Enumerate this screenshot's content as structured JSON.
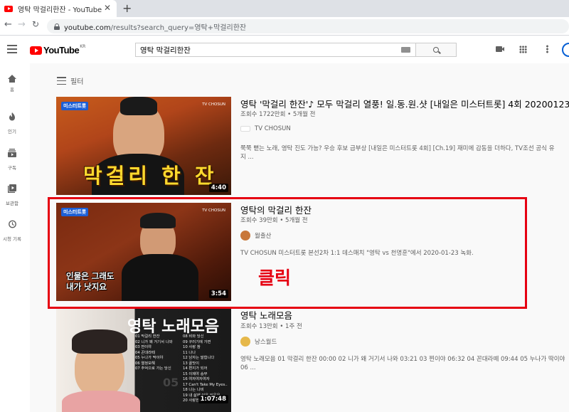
{
  "browser": {
    "tab_title": "영탁 막걸리한잔 - YouTube",
    "url_host": "youtube.com",
    "url_path": "/results?search_query=영탁+막걸리한잔"
  },
  "masthead": {
    "logo_text": "YouTube",
    "logo_region": "KR",
    "search_value": "영탁 막걸리한잔"
  },
  "guide": [
    {
      "label": "홈",
      "icon": "home-icon"
    },
    {
      "label": "인기",
      "icon": "fire-icon"
    },
    {
      "label": "구독",
      "icon": "subscriptions-icon"
    },
    {
      "label": "보관함",
      "icon": "library-icon"
    },
    {
      "label": "시청 기록",
      "icon": "history-icon"
    }
  ],
  "filter_label": "필터",
  "results": [
    {
      "title": "영탁 '막걸리 한잔'♪ 모두 막걸리 열풍! 일.동.원.샷 [내일은 미스터트롯] 4회 20200123",
      "meta": "조회수 1722만회 • 5개월 전",
      "channel": "TV CHOSUN",
      "desc_line1": "쭉쭉 뻗는 노래, 영탁 진도 가능? 우승 후보 급부상 [내일은 미스터트롯 4회] [Ch.19] 재미에 감동을 더하다, TV조선 공식 유",
      "desc_line2": "지 ...",
      "duration": "4:40",
      "thumb_caption": "막걸리 한 잔",
      "thumb_logo": "미스터트롯",
      "thumb_brand": "TV CHOSUN"
    },
    {
      "title": "영탁의 막걸리 한잔",
      "meta": "조회수 39만회 • 5개월 전",
      "channel": "월출산",
      "desc_line1": "TV CHOSUN 미스터트롯 본선2차 1:1 데스매치 \"영탁 vs 천명훈\"에서 2020-01-23 녹화.",
      "desc_line2": "",
      "duration": "3:54",
      "thumb_caption_1": "인물은 그래도",
      "thumb_caption_2": "내가 낫지요",
      "thumb_logo": "미스터트롯",
      "thumb_brand": "TV CHOSUN"
    },
    {
      "title": "영탁 노래모음",
      "meta": "조회수 13만회 • 1주 전",
      "channel": "낭스월드",
      "desc_line1": "영탁 노래모음 01 막걸리 한잔 00:00 02 니가 왜 거기서 나와 03:21 03 찐이야 06:32 04 꼰대라떼 09:44 05 누나가 딱이야",
      "desc_line2": "06 ...",
      "duration": "1:07:48",
      "thumb_title": "영탁 노래모음",
      "thumb_big_num": "05",
      "thumb_songs_left": [
        "01 막걸리 한잔",
        "02 니가 왜 거기서 나와",
        "03 찐이야",
        "04 꼰대라떼",
        "05 누나가 딱이야",
        "06 열정모해",
        "07 추억으로 가는 당신"
      ],
      "thumb_songs_right": [
        "08 비와 당신",
        "09 꾸러기에 가면",
        "10 사랑 참",
        "11 나나",
        "12 남자는 말합니다",
        "13 꿀맛이",
        "14 편지가 되어",
        "15 이제야 승부",
        "16 여자여자여자",
        "17 Can't Take My Eyes..",
        "18 나는 나비",
        "19 내 삶에 이유 있음은",
        "20 사랑한다"
      ]
    }
  ],
  "annotation": {
    "label": "클릭",
    "color": "#e60012"
  },
  "colors": {
    "youtube_red": "#ff0000",
    "text_primary": "#030303",
    "text_secondary": "#606060",
    "page_bg": "#f9f9f9"
  }
}
